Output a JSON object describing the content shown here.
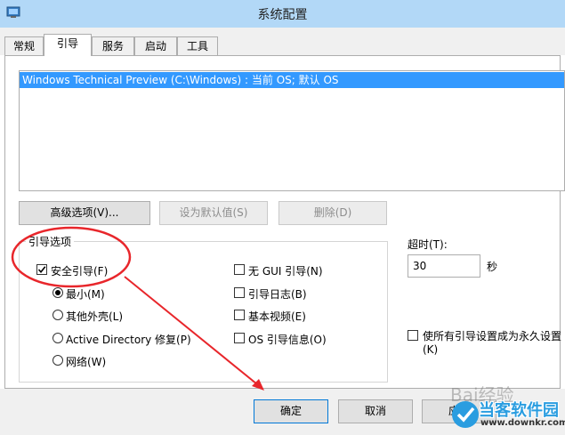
{
  "window": {
    "title": "系统配置"
  },
  "tabs": [
    {
      "label": "常规"
    },
    {
      "label": "引导"
    },
    {
      "label": "服务"
    },
    {
      "label": "启动"
    },
    {
      "label": "工具"
    }
  ],
  "os_list": {
    "entries": [
      "Windows Technical Preview (C:\\Windows) : 当前 OS; 默认 OS"
    ]
  },
  "buttons": {
    "advanced": "高级选项(V)...",
    "set_default": "设为默认值(S)",
    "delete": "删除(D)"
  },
  "boot_options": {
    "title": "引导选项",
    "safe_boot": {
      "label": "安全引导(F)",
      "checked": true
    },
    "modes": [
      {
        "label": "最小(M)",
        "selected": true
      },
      {
        "label": "其他外壳(L)",
        "selected": false
      },
      {
        "label": "Active Directory 修复(P)",
        "selected": false
      },
      {
        "label": "网络(W)",
        "selected": false
      }
    ],
    "flags": [
      {
        "label": "无 GUI 引导(N)",
        "checked": false
      },
      {
        "label": "引导日志(B)",
        "checked": false
      },
      {
        "label": "基本视频(E)",
        "checked": false
      },
      {
        "label": "OS 引导信息(O)",
        "checked": false
      }
    ]
  },
  "timeout": {
    "label": "超时(T):",
    "value": "30",
    "unit": "秒"
  },
  "permanent": {
    "label_line1": "使所有引导设置成为永久设置",
    "label_line2": "(K)",
    "checked": false
  },
  "footer": {
    "ok": "确定",
    "cancel": "取消",
    "apply_partial": "应用"
  },
  "watermark": {
    "baidu": "Bai经验",
    "logo_title": "当客软件园",
    "logo_url": "www.downkr.com"
  },
  "colors": {
    "titlebar": "#b2d8f7",
    "selection": "#3399ff",
    "annotation": "#e8262b"
  }
}
